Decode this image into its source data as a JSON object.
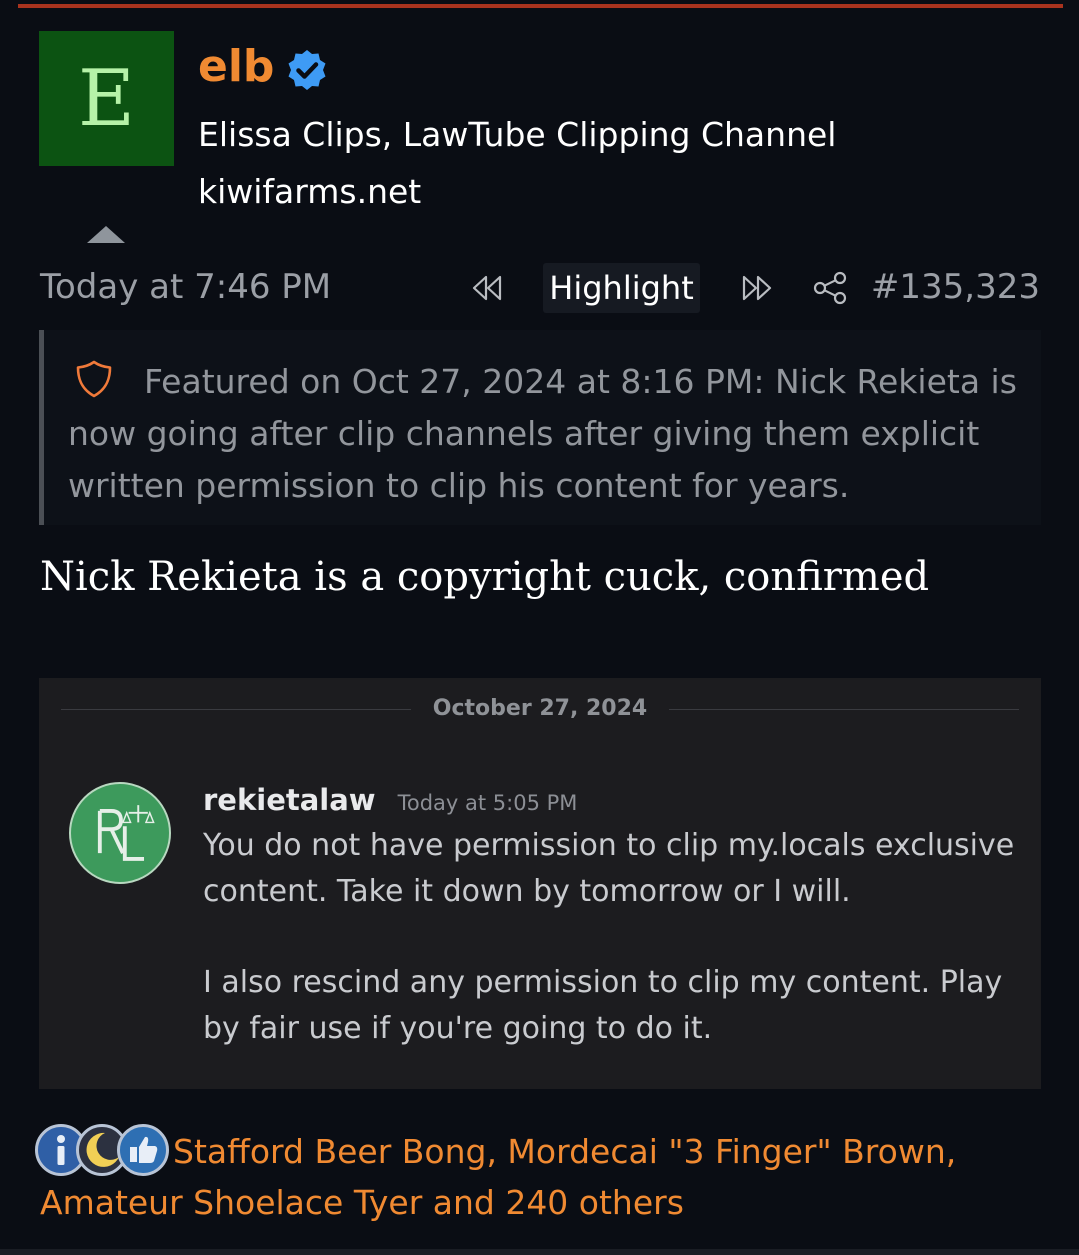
{
  "post": {
    "author": {
      "avatar_letter": "E",
      "username": "elb",
      "title": "Elissa Clips, LawTube Clipping Channel",
      "site": "kiwifarms.net"
    },
    "timestamp": "Today at 7:46 PM",
    "highlight_label": "Highlight",
    "post_number": "#135,323",
    "featured": "Featured on Oct 27, 2024 at 8:16 PM: Nick Rekieta is now going after clip channels after giving them explicit written permission to clip his content for years.",
    "body": "Nick Rekieta is a copyright cuck, confirmed"
  },
  "screenshot": {
    "date": "October 27, 2024",
    "author": "rekietalaw",
    "time": "Today at 5:05 PM",
    "paragraph1": "You do not have permission to clip my.locals exclusive content.  Take it down by tomorrow or I will.",
    "paragraph2": "I also rescind any permission to clip my content.  Play by fair use if you're going to do it."
  },
  "reactions": {
    "text": "Stafford Beer Bong, Mordecai \"3 Finger\" Brown, Amateur Shoelace Tyer and 240 others"
  },
  "icons": [
    "verified-badge-icon",
    "shield-icon",
    "rewind-icon",
    "fast-forward-icon",
    "share-icon",
    "informative-icon",
    "moon-icon",
    "thumbs-up-icon"
  ],
  "colors": {
    "accent": "#f08a32",
    "verified": "#3e9bf5",
    "avatar_bg": "#0c5312",
    "top_bar": "#a8331e"
  }
}
